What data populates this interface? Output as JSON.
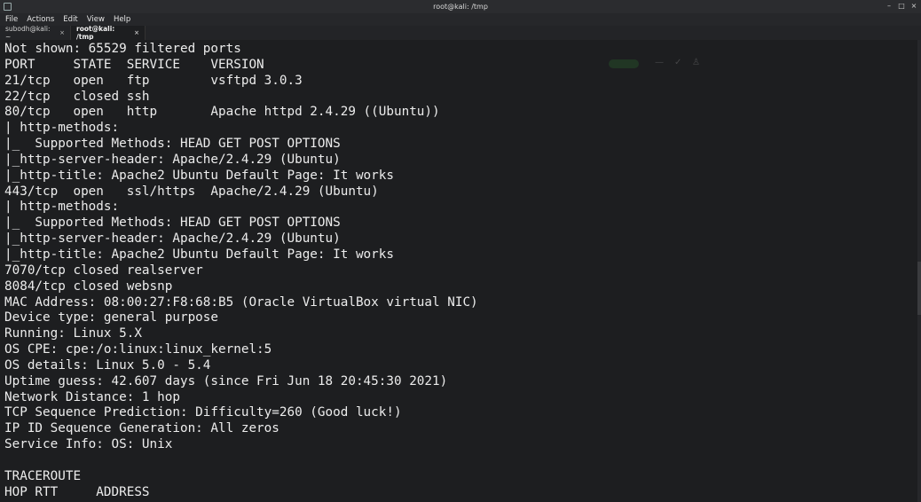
{
  "window": {
    "title": "root@kali: /tmp",
    "controls": [
      "–",
      "□",
      "×"
    ]
  },
  "menubar": {
    "items": [
      "File",
      "Actions",
      "Edit",
      "View",
      "Help"
    ]
  },
  "tabs": [
    {
      "label": "subodh@kali: ~",
      "close": "×",
      "active": false
    },
    {
      "label": "root@kali: /tmp",
      "close": "×",
      "active": true
    }
  ],
  "terminal": {
    "lines": [
      "Not shown: 65529 filtered ports",
      "PORT     STATE  SERVICE    VERSION",
      "21/tcp   open   ftp        vsftpd 3.0.3",
      "22/tcp   closed ssh",
      "80/tcp   open   http       Apache httpd 2.4.29 ((Ubuntu))",
      "| http-methods:",
      "|_  Supported Methods: HEAD GET POST OPTIONS",
      "|_http-server-header: Apache/2.4.29 (Ubuntu)",
      "|_http-title: Apache2 Ubuntu Default Page: It works",
      "443/tcp  open   ssl/https  Apache/2.4.29 (Ubuntu)",
      "| http-methods:",
      "|_  Supported Methods: HEAD GET POST OPTIONS",
      "|_http-server-header: Apache/2.4.29 (Ubuntu)",
      "|_http-title: Apache2 Ubuntu Default Page: It works",
      "7070/tcp closed realserver",
      "8084/tcp closed websnp",
      "MAC Address: 08:00:27:F8:68:B5 (Oracle VirtualBox virtual NIC)",
      "Device type: general purpose",
      "Running: Linux 5.X",
      "OS CPE: cpe:/o:linux:linux_kernel:5",
      "OS details: Linux 5.0 - 5.4",
      "Uptime guess: 42.607 days (since Fri Jun 18 20:45:30 2021)",
      "Network Distance: 1 hop",
      "TCP Sequence Prediction: Difficulty=260 (Good luck!)",
      "IP ID Sequence Generation: All zeros",
      "Service Info: OS: Unix",
      "",
      "TRACEROUTE",
      "HOP RTT     ADDRESS"
    ]
  },
  "colors": {
    "background": "#1d1e20",
    "foreground": "#ececec",
    "titlebar": "#2b2c2f",
    "menubar": "#26272a"
  }
}
